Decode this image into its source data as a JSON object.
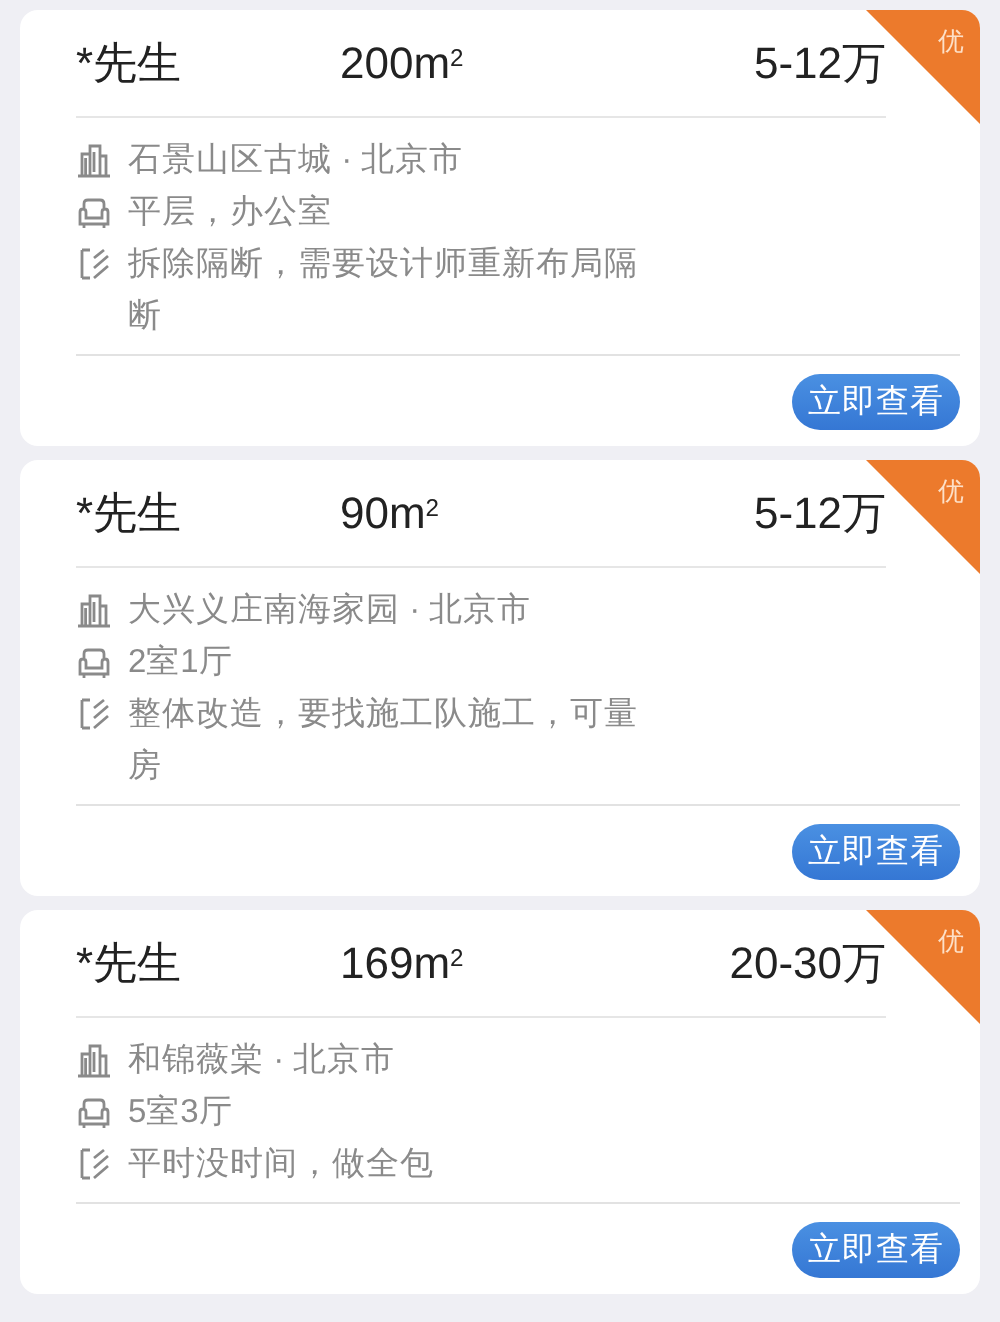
{
  "listings": [
    {
      "name": "*先生",
      "area": "200m$^{2}$",
      "budget": "5-12万",
      "badge": "优",
      "location": "石景山区古城 · 北京市",
      "layout": "平层，办公室",
      "note": "拆除隔断，需要设计师重新布局隔断",
      "button": "立即查看"
    },
    {
      "name": "*先生",
      "area": "90m$^{2}$",
      "budget": "5-12万",
      "badge": "优",
      "location": "大兴义庄南海家园 · 北京市",
      "layout": "2室1厅",
      "note": "整体改造，要找施工队施工，可量房",
      "button": "立即查看"
    },
    {
      "name": "*先生",
      "area": "169m$^{2}$",
      "budget": "20-30万",
      "badge": "优",
      "location": "和锦薇棠 · 北京市",
      "layout": "5室3厅",
      "note": "平时没时间，做全包",
      "button": "立即查看"
    }
  ]
}
